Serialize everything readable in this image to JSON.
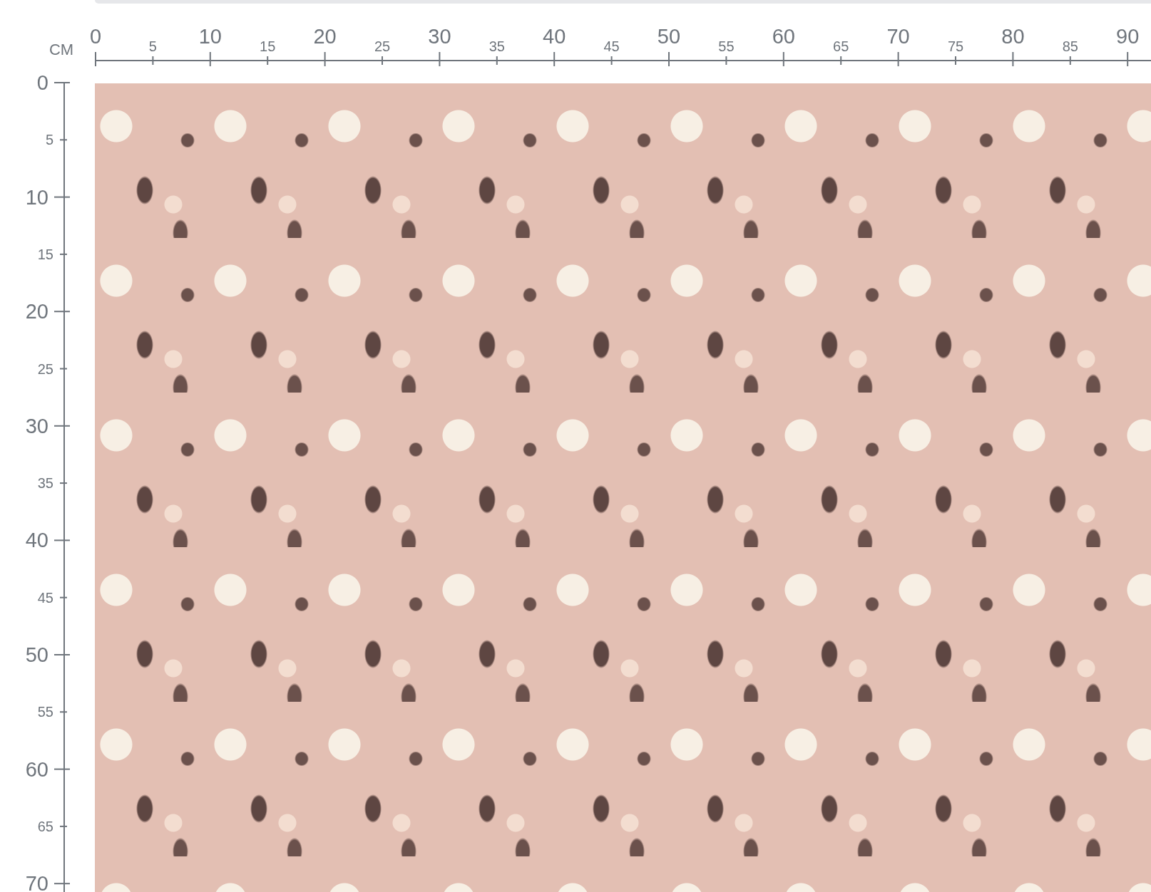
{
  "unit": "CM",
  "top_ruler": {
    "labels": [
      {
        "text": "0",
        "kind": "major"
      },
      {
        "text": "5",
        "kind": "minor"
      },
      {
        "text": "10",
        "kind": "major"
      },
      {
        "text": "15",
        "kind": "minor"
      },
      {
        "text": "20",
        "kind": "major"
      },
      {
        "text": "25",
        "kind": "minor"
      },
      {
        "text": "30",
        "kind": "major"
      },
      {
        "text": "35",
        "kind": "minor"
      },
      {
        "text": "40",
        "kind": "major"
      },
      {
        "text": "45",
        "kind": "minor"
      },
      {
        "text": "50",
        "kind": "major"
      },
      {
        "text": "55",
        "kind": "minor"
      },
      {
        "text": "60",
        "kind": "major"
      },
      {
        "text": "65",
        "kind": "minor"
      },
      {
        "text": "70",
        "kind": "major"
      },
      {
        "text": "75",
        "kind": "minor"
      },
      {
        "text": "80",
        "kind": "major"
      },
      {
        "text": "85",
        "kind": "minor"
      },
      {
        "text": "90",
        "kind": "major"
      }
    ]
  },
  "left_ruler": {
    "labels": [
      {
        "text": "0",
        "kind": "major"
      },
      {
        "text": "5",
        "kind": "minor"
      },
      {
        "text": "10",
        "kind": "major"
      },
      {
        "text": "15",
        "kind": "minor"
      },
      {
        "text": "20",
        "kind": "major"
      },
      {
        "text": "25",
        "kind": "minor"
      },
      {
        "text": "30",
        "kind": "major"
      },
      {
        "text": "35",
        "kind": "minor"
      },
      {
        "text": "40",
        "kind": "major"
      },
      {
        "text": "45",
        "kind": "minor"
      },
      {
        "text": "50",
        "kind": "major"
      },
      {
        "text": "55",
        "kind": "minor"
      },
      {
        "text": "60",
        "kind": "major"
      },
      {
        "text": "65",
        "kind": "minor"
      },
      {
        "text": "70",
        "kind": "major"
      }
    ]
  }
}
